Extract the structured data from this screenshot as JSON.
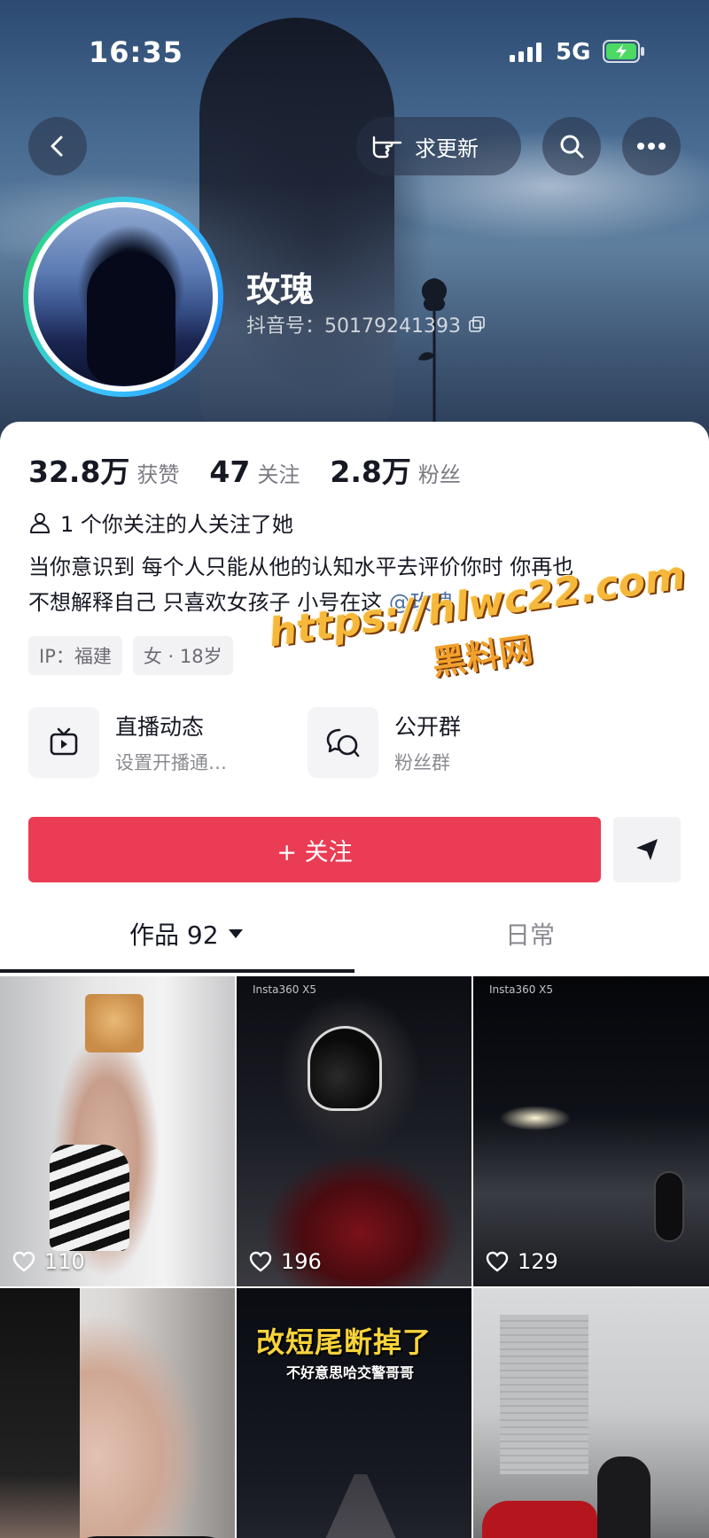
{
  "status_bar": {
    "time": "16:35",
    "network": "5G"
  },
  "header": {
    "request_update_label": "求更新"
  },
  "profile": {
    "name": "玫瑰",
    "douyin_id": "抖音号：50179241393"
  },
  "stats": [
    {
      "value": "32.8万",
      "label": "获赞"
    },
    {
      "value": "47",
      "label": "关注"
    },
    {
      "value": "2.8万",
      "label": "粉丝"
    }
  ],
  "mutual_text": "1 个你关注的人关注了她",
  "bio": {
    "line1": "当你意识到 每个人只能从他的认知水平去评价你时 你再也",
    "line2": "不想解释自己 只喜欢女孩子 小号在这 ",
    "mention": "@玫瑰"
  },
  "tags": [
    "IP：福建",
    "女 · 18岁"
  ],
  "entries": {
    "live": {
      "title": "直播动态",
      "subtitle": "设置开播通…"
    },
    "group": {
      "title": "公开群",
      "subtitle": "粉丝群"
    }
  },
  "follow_label": "+ 关注",
  "tabs": {
    "works": "作品 92",
    "daily": "日常"
  },
  "videos": [
    {
      "likes": "110"
    },
    {
      "likes": "196",
      "watermark": "Insta360 X5"
    },
    {
      "likes": "129",
      "watermark": "Insta360 X5"
    },
    {
      "title": "改短尾断掉了",
      "subtitle": "不好意思哈交警哥哥"
    }
  ],
  "watermark": {
    "line1": "https://hlwc22.com",
    "line2": "黑料网"
  },
  "colors": {
    "accent_red": "#ea3c54",
    "mention_blue": "#4a6fa5"
  }
}
